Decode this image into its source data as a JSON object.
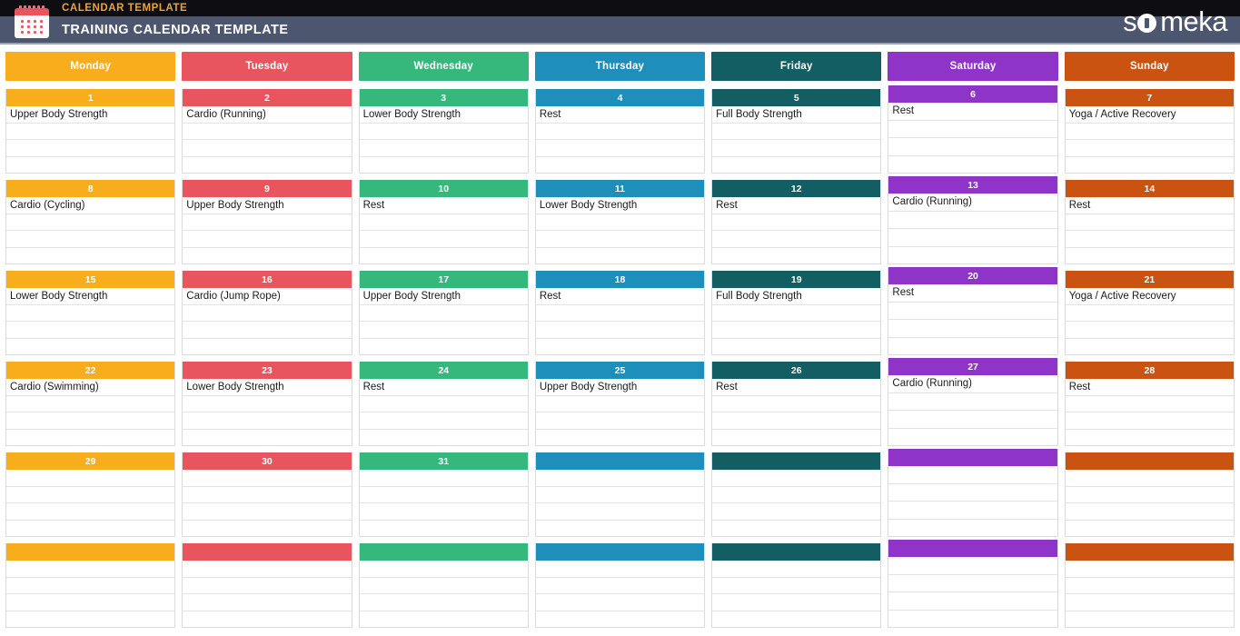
{
  "header": {
    "eyebrow": "CALENDAR TEMPLATE",
    "title": "TRAINING CALENDAR TEMPLATE",
    "brand_prefix": "s",
    "brand_suffix": "meka",
    "icon": "calendar-icon",
    "eyebrow_color": "#e8a33d",
    "band_color": "#4c566e",
    "top_color": "#0d0d12"
  },
  "weekdays": [
    {
      "label": "Monday",
      "color": "#f8ad1c"
    },
    {
      "label": "Tuesday",
      "color": "#e8555f"
    },
    {
      "label": "Wednesday",
      "color": "#36b87d"
    },
    {
      "label": "Thursday",
      "color": "#1d8fba"
    },
    {
      "label": "Friday",
      "color": "#125e63"
    },
    {
      "label": "Saturday",
      "color": "#8e34c9"
    },
    {
      "label": "Sunday",
      "color": "#cb5311"
    }
  ],
  "lines_per_cell": 4,
  "weeks": [
    {
      "days": [
        {
          "date": "1",
          "entries": [
            "Upper Body Strength"
          ]
        },
        {
          "date": "2",
          "entries": [
            "Cardio (Running)"
          ]
        },
        {
          "date": "3",
          "entries": [
            "Lower Body Strength"
          ]
        },
        {
          "date": "4",
          "entries": [
            "Rest"
          ]
        },
        {
          "date": "5",
          "entries": [
            "Full Body Strength"
          ]
        },
        {
          "date": "6",
          "entries": [
            "Rest"
          ]
        },
        {
          "date": "7",
          "entries": [
            "Yoga / Active Recovery"
          ]
        }
      ]
    },
    {
      "days": [
        {
          "date": "8",
          "entries": [
            "Cardio (Cycling)"
          ]
        },
        {
          "date": "9",
          "entries": [
            "Upper Body Strength"
          ]
        },
        {
          "date": "10",
          "entries": [
            "Rest"
          ]
        },
        {
          "date": "11",
          "entries": [
            "Lower Body Strength"
          ]
        },
        {
          "date": "12",
          "entries": [
            "Rest"
          ]
        },
        {
          "date": "13",
          "entries": [
            "Cardio (Running)"
          ]
        },
        {
          "date": "14",
          "entries": [
            "Rest"
          ]
        }
      ]
    },
    {
      "days": [
        {
          "date": "15",
          "entries": [
            "Lower Body Strength"
          ]
        },
        {
          "date": "16",
          "entries": [
            "Cardio (Jump Rope)"
          ]
        },
        {
          "date": "17",
          "entries": [
            "Upper Body Strength"
          ]
        },
        {
          "date": "18",
          "entries": [
            "Rest"
          ]
        },
        {
          "date": "19",
          "entries": [
            "Full Body Strength"
          ]
        },
        {
          "date": "20",
          "entries": [
            "Rest"
          ]
        },
        {
          "date": "21",
          "entries": [
            "Yoga / Active Recovery"
          ]
        }
      ]
    },
    {
      "days": [
        {
          "date": "22",
          "entries": [
            "Cardio (Swimming)"
          ]
        },
        {
          "date": "23",
          "entries": [
            "Lower Body Strength"
          ]
        },
        {
          "date": "24",
          "entries": [
            "Rest"
          ]
        },
        {
          "date": "25",
          "entries": [
            "Upper Body Strength"
          ]
        },
        {
          "date": "26",
          "entries": [
            "Rest"
          ]
        },
        {
          "date": "27",
          "entries": [
            "Cardio (Running)"
          ]
        },
        {
          "date": "28",
          "entries": [
            "Rest"
          ]
        }
      ]
    },
    {
      "days": [
        {
          "date": "29",
          "entries": []
        },
        {
          "date": "30",
          "entries": []
        },
        {
          "date": "31",
          "entries": []
        },
        {
          "date": "",
          "entries": []
        },
        {
          "date": "",
          "entries": []
        },
        {
          "date": "",
          "entries": []
        },
        {
          "date": "",
          "entries": []
        }
      ]
    },
    {
      "days": [
        {
          "date": "",
          "entries": []
        },
        {
          "date": "",
          "entries": []
        },
        {
          "date": "",
          "entries": []
        },
        {
          "date": "",
          "entries": []
        },
        {
          "date": "",
          "entries": []
        },
        {
          "date": "",
          "entries": []
        },
        {
          "date": "",
          "entries": []
        }
      ]
    }
  ]
}
